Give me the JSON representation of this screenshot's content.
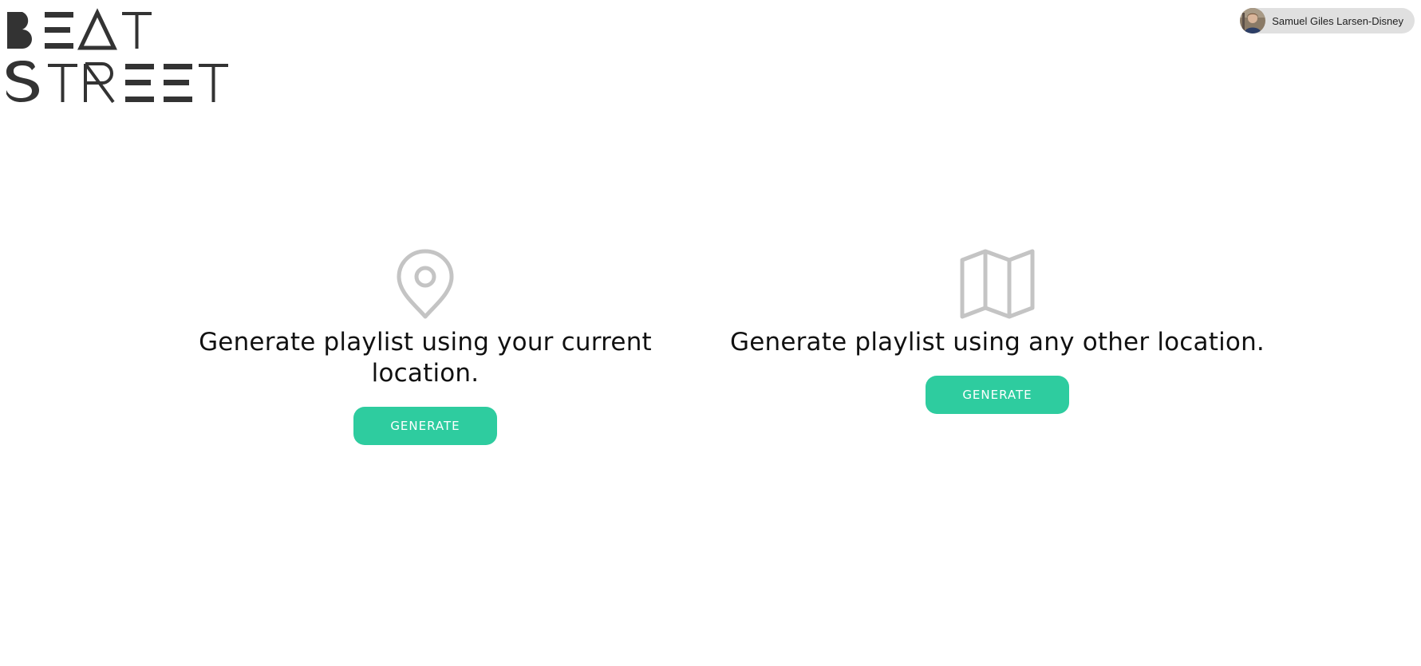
{
  "brand": {
    "line1": "BEAT",
    "line2": "STREET",
    "logo_color": "#333333"
  },
  "user": {
    "name": "Samuel Giles Larsen-Disney",
    "chip_color": "#e0e0e0"
  },
  "options": [
    {
      "icon": "location-pin-icon",
      "text": "Generate playlist using your current location.",
      "button_label": "GENERATE"
    },
    {
      "icon": "map-icon",
      "text": "Generate playlist using any other location.",
      "button_label": "GENERATE"
    }
  ],
  "colors": {
    "accent": "#2ecc9f",
    "icon": "#c4c4c4",
    "text": "#111111"
  }
}
